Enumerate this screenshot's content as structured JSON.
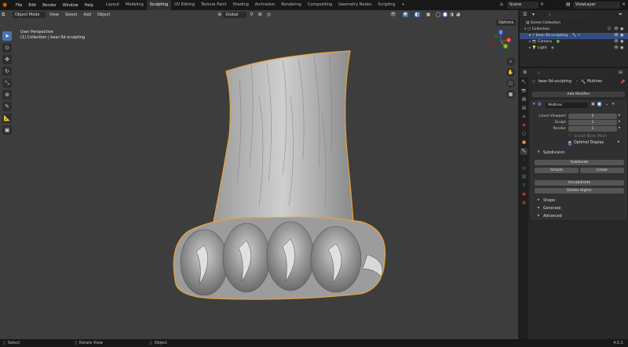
{
  "topbar": {
    "menus": [
      "File",
      "Edit",
      "Render",
      "Window",
      "Help"
    ],
    "workspaces": [
      "Layout",
      "Modeling",
      "Sculpting",
      "UV Editing",
      "Texture Paint",
      "Shading",
      "Animation",
      "Rendering",
      "Compositing",
      "Geometry Nodes",
      "Scripting"
    ],
    "active_workspace": "Sculpting",
    "add_tab": "+",
    "scene": "Scene",
    "view_layer": "ViewLayer"
  },
  "viewport": {
    "mode": "Object Mode",
    "menus": [
      "View",
      "Select",
      "Add",
      "Object"
    ],
    "orientation": "Global",
    "overlay_title": "User Perspective",
    "overlay_subtitle": "(1) Collection | bear-3d-sculpting",
    "options": "Options",
    "gizmo_labels": {
      "z": "Z",
      "y": "Y",
      "x": "X"
    }
  },
  "outliner": {
    "search_placeholder": "",
    "rows": [
      {
        "label": "Scene Collection"
      },
      {
        "label": "Collection"
      },
      {
        "label": "bear-3d-sculpting"
      },
      {
        "label": "Camera"
      },
      {
        "label": "Light"
      }
    ]
  },
  "properties": {
    "object_name": "bear-3d-sculpting",
    "modifier_context": "Multires",
    "add_modifier": "Add Modifier",
    "modifier_name": "Multires",
    "level_viewport_label": "Level Viewport",
    "level_viewport": "1",
    "sculpt_label": "Sculpt",
    "sculpt": "1",
    "render_label": "Render",
    "render": "1",
    "sculpt_base_mesh": "Sculpt Base Mesh",
    "optimal_display": "Optimal Display",
    "subdivision_section": "Subdivision",
    "subdivide": "Subdivide",
    "simple": "Simple",
    "linear": "Linear",
    "unsubdivide": "Unsubdivide",
    "delete_higher": "Delete Higher",
    "shape_section": "Shape",
    "generate_section": "Generate",
    "advanced_section": "Advanced"
  },
  "statusbar": {
    "select": "Select",
    "rotate_view": "Rotate View",
    "object": "Object",
    "version": "4.0.1"
  },
  "colors": {
    "accent": "#4772b3",
    "selection_outline": "#e8a33a",
    "viewport_bg": "#3d3d3d",
    "panel_bg": "#282828"
  }
}
